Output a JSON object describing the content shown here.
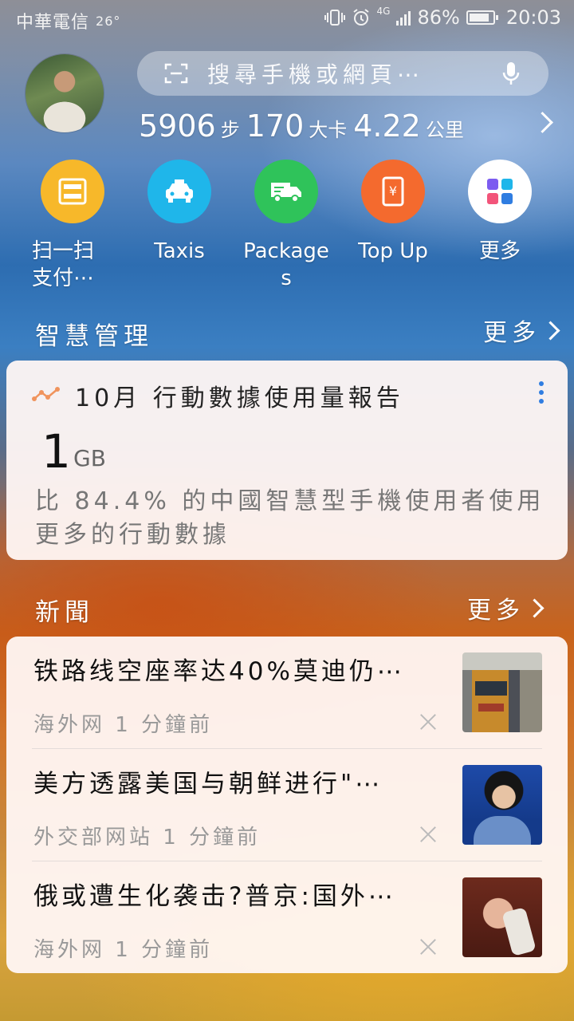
{
  "status_bar": {
    "carrier": "中華電信",
    "temperature": "26°",
    "network": "4G",
    "battery_percent": "86%",
    "battery_level": 0.86,
    "time": "20:03"
  },
  "search": {
    "placeholder": "搜尋手機或網頁⋯"
  },
  "stats": {
    "steps": "5906",
    "steps_unit": "步",
    "calories": "170",
    "calories_unit": "大卡",
    "distance": "4.22",
    "distance_unit": "公里"
  },
  "shortcuts": [
    {
      "label": "扫一扫\n支付⋯",
      "icon": "scan-icon",
      "color": "#f7b82a"
    },
    {
      "label": "Taxis",
      "icon": "taxi-icon",
      "color": "#1fb6ea"
    },
    {
      "label": "Package\ns",
      "icon": "truck-icon",
      "color": "#2fc35a"
    },
    {
      "label": "Top Up",
      "icon": "top-up-icon",
      "color": "#f46a2e"
    },
    {
      "label": "更多",
      "icon": "apps-grid-icon",
      "color": "#ffffff"
    }
  ],
  "smart": {
    "title": "智慧管理",
    "more": "更多",
    "card_title": "10月 行動數據使用量報告",
    "value": "1",
    "unit": "GB",
    "description": "比 84.4% 的中國智慧型手機使用者使用更多的行動數據"
  },
  "news": {
    "title": "新聞",
    "more": "更多",
    "items": [
      {
        "headline": "铁路线空座率达40%莫迪仍⋯",
        "meta": "海外网 1 分鐘前"
      },
      {
        "headline": "美方透露美国与朝鲜进行\"⋯",
        "meta": "外交部网站 1 分鐘前"
      },
      {
        "headline": "俄或遭生化袭击?普京:国外⋯",
        "meta": "海外网 1 分鐘前"
      }
    ]
  }
}
